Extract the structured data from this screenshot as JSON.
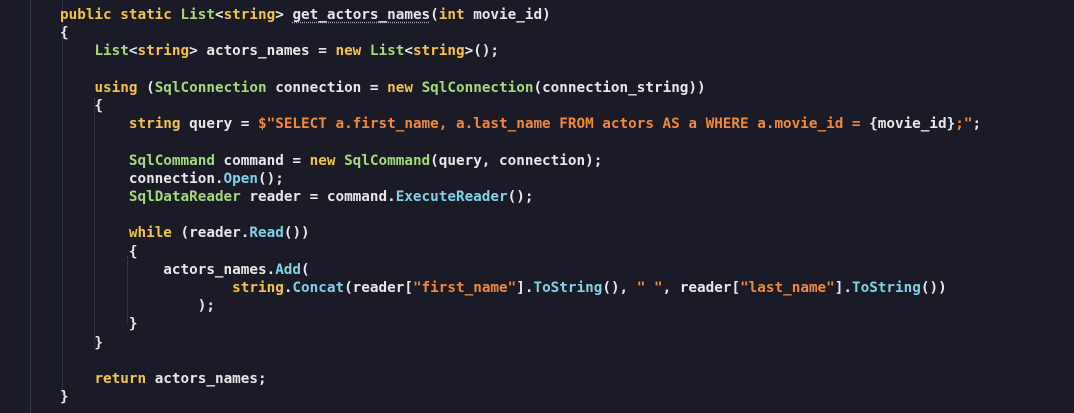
{
  "editor": {
    "theme": {
      "background": "#1a1b26",
      "keyword": "#f3c34a",
      "type": "#a6d97a",
      "method": "#7fd3e6",
      "string": "#f2893a",
      "text": "#e8e8ea"
    },
    "lines": [
      {
        "tokens": [
          [
            "kw",
            "public static "
          ],
          [
            "type",
            "List"
          ],
          [
            "txt",
            "<"
          ],
          [
            "kw",
            "string"
          ],
          [
            "txt",
            "> "
          ],
          [
            "fnname",
            "get_actors_names"
          ],
          [
            "txt",
            "("
          ],
          [
            "kw",
            "int"
          ],
          [
            "txt",
            " movie_id)"
          ]
        ]
      },
      {
        "tokens": [
          [
            "txt",
            "{"
          ]
        ]
      },
      {
        "tokens": [
          [
            "txt",
            "    "
          ],
          [
            "type",
            "List"
          ],
          [
            "txt",
            "<"
          ],
          [
            "kw",
            "string"
          ],
          [
            "txt",
            "> actors_names = "
          ],
          [
            "kw",
            "new "
          ],
          [
            "type",
            "List"
          ],
          [
            "txt",
            "<"
          ],
          [
            "kw",
            "string"
          ],
          [
            "txt",
            ">();"
          ]
        ]
      },
      {
        "tokens": []
      },
      {
        "tokens": [
          [
            "txt",
            "    "
          ],
          [
            "kw",
            "using "
          ],
          [
            "txt",
            "("
          ],
          [
            "type",
            "SqlConnection"
          ],
          [
            "txt",
            " connection = "
          ],
          [
            "kw",
            "new "
          ],
          [
            "type",
            "SqlConnection"
          ],
          [
            "txt",
            "(connection_string))"
          ]
        ]
      },
      {
        "tokens": [
          [
            "txt",
            "    {"
          ]
        ]
      },
      {
        "tokens": [
          [
            "txt",
            "        "
          ],
          [
            "kw",
            "string"
          ],
          [
            "txt",
            " query = "
          ],
          [
            "str",
            "$\"SELECT a.first_name, a.last_name FROM actors AS a WHERE a.movie_id = "
          ],
          [
            "txt",
            "{movie_id}"
          ],
          [
            "str",
            ";\""
          ],
          [
            "txt",
            ";"
          ]
        ]
      },
      {
        "tokens": []
      },
      {
        "tokens": [
          [
            "txt",
            "        "
          ],
          [
            "type",
            "SqlCommand"
          ],
          [
            "txt",
            " command = "
          ],
          [
            "kw",
            "new "
          ],
          [
            "type",
            "SqlCommand"
          ],
          [
            "txt",
            "(query, connection);"
          ]
        ]
      },
      {
        "tokens": [
          [
            "txt",
            "        connection."
          ],
          [
            "fn",
            "Open"
          ],
          [
            "txt",
            "();"
          ]
        ]
      },
      {
        "tokens": [
          [
            "txt",
            "        "
          ],
          [
            "type",
            "SqlDataReader"
          ],
          [
            "txt",
            " reader = command."
          ],
          [
            "fn",
            "ExecuteReader"
          ],
          [
            "txt",
            "();"
          ]
        ]
      },
      {
        "tokens": []
      },
      {
        "tokens": [
          [
            "txt",
            "        "
          ],
          [
            "kw",
            "while "
          ],
          [
            "txt",
            "(reader."
          ],
          [
            "fn",
            "Read"
          ],
          [
            "txt",
            "())"
          ]
        ]
      },
      {
        "tokens": [
          [
            "txt",
            "        {"
          ]
        ]
      },
      {
        "tokens": [
          [
            "txt",
            "            actors_names."
          ],
          [
            "fn",
            "Add"
          ],
          [
            "txt",
            "("
          ]
        ]
      },
      {
        "tokens": [
          [
            "txt",
            "                    "
          ],
          [
            "kw",
            "string"
          ],
          [
            "txt",
            "."
          ],
          [
            "fn",
            "Concat"
          ],
          [
            "txt",
            "(reader["
          ],
          [
            "str",
            "\"first_name\""
          ],
          [
            "txt",
            "]."
          ],
          [
            "fn",
            "ToString"
          ],
          [
            "txt",
            "(), "
          ],
          [
            "str",
            "\" \""
          ],
          [
            "txt",
            ", reader["
          ],
          [
            "str",
            "\"last_name\""
          ],
          [
            "txt",
            "]."
          ],
          [
            "fn",
            "ToString"
          ],
          [
            "txt",
            "())"
          ]
        ]
      },
      {
        "tokens": [
          [
            "txt",
            "                );"
          ]
        ]
      },
      {
        "tokens": [
          [
            "txt",
            "        }"
          ]
        ]
      },
      {
        "tokens": [
          [
            "txt",
            "    }"
          ]
        ]
      },
      {
        "tokens": []
      },
      {
        "tokens": [
          [
            "txt",
            "    "
          ],
          [
            "kw",
            "return "
          ],
          [
            "txt",
            "actors_names;"
          ]
        ]
      },
      {
        "tokens": [
          [
            "txt",
            "}"
          ]
        ]
      }
    ]
  }
}
